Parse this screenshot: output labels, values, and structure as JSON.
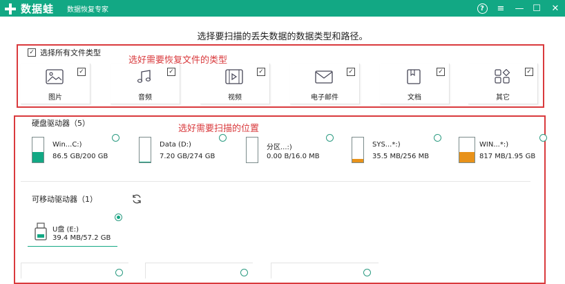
{
  "titlebar": {
    "app_name": "数据蛙",
    "subtitle": "数据恢复专家",
    "help_label": "?",
    "menu_label": "≡",
    "minimize_label": "—",
    "maximize_label": "☐",
    "close_label": "✕"
  },
  "heading": "选择要扫描的丢失数据的数据类型和路径。",
  "file_types": {
    "select_all_label": "选择所有文件类型",
    "select_all_checked": true,
    "items": [
      {
        "label": "图片",
        "icon": "image-icon",
        "checked": true
      },
      {
        "label": "音频",
        "icon": "music-icon",
        "checked": true
      },
      {
        "label": "视频",
        "icon": "video-icon",
        "checked": true
      },
      {
        "label": "电子邮件",
        "icon": "mail-icon",
        "checked": true
      },
      {
        "label": "文档",
        "icon": "document-icon",
        "checked": true
      },
      {
        "label": "其它",
        "icon": "other-icon",
        "checked": true
      }
    ]
  },
  "annotations": {
    "types_note": "选好需要恢复文件的类型",
    "location_note": "选好需要扫描的位置",
    "color": "#d9393c"
  },
  "hard_drives": {
    "title": "硬盘驱动器（5）",
    "items": [
      {
        "name": "Win...C:)",
        "size": "86.5 GB/200 GB",
        "used_fraction": 0.43,
        "fill_color": "#12a884",
        "selected": false
      },
      {
        "name": "Data (D:)",
        "size": "7.20 GB/274 GB",
        "used_fraction": 0.03,
        "fill_color": "#12a884",
        "selected": false
      },
      {
        "name": "分区...:)",
        "size": "0.00 B/16.0 MB",
        "used_fraction": 0.0,
        "fill_color": "#f0a020",
        "selected": false
      },
      {
        "name": "SYS...*:)",
        "size": "35.5 MB/256 MB",
        "used_fraction": 0.14,
        "fill_color": "#e8921a",
        "selected": false
      },
      {
        "name": "WIN...*:)",
        "size": "817 MB/1.95 GB",
        "used_fraction": 0.42,
        "fill_color": "#e8921a",
        "selected": false
      }
    ]
  },
  "removable": {
    "title": "可移动驱动器（1）",
    "refresh_icon": "refresh-icon",
    "items": [
      {
        "name": "U盘 (E:)",
        "size": "39.4 MB/57.2 GB",
        "selected": true
      }
    ]
  },
  "colors": {
    "brand": "#12a884",
    "annotation": "#d9393c"
  }
}
